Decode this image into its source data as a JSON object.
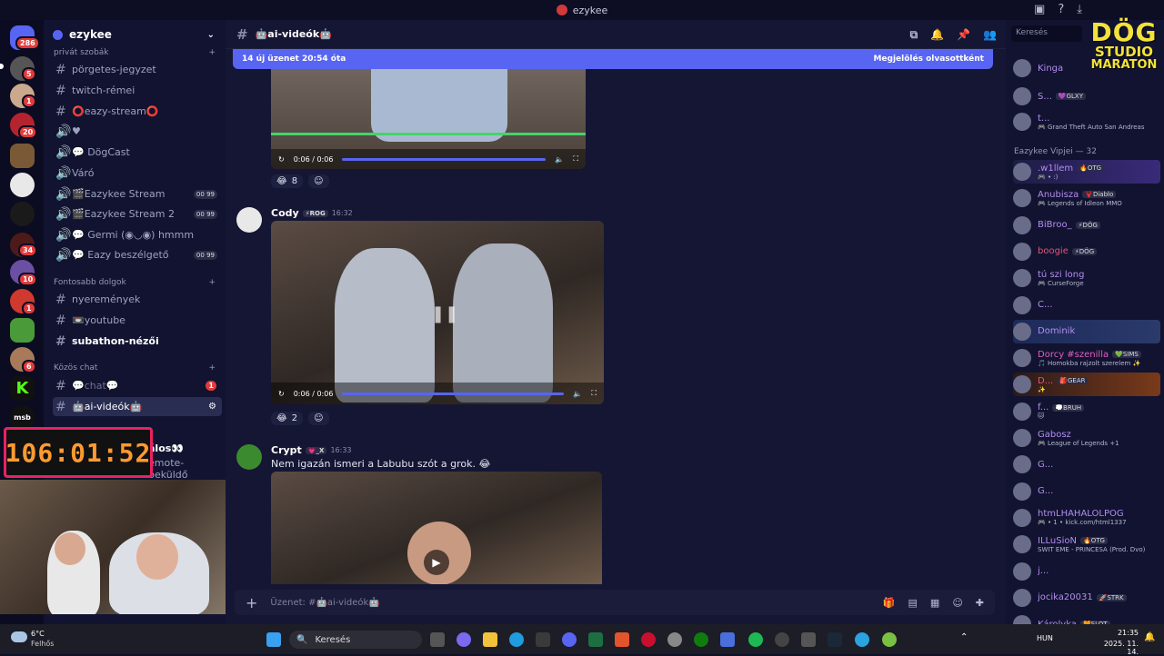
{
  "window": {
    "title": "ezykee"
  },
  "servers": {
    "badges": [
      "286",
      "5",
      "1",
      "20",
      "34",
      "10",
      "1",
      "6"
    ]
  },
  "server": {
    "name": "ezykee"
  },
  "channels": {
    "cat1": "privát szobák",
    "items1": [
      {
        "name": "pörgetes-jegyzet"
      },
      {
        "name": "twitch-rémei"
      },
      {
        "name": "⭕eazy-stream⭕"
      },
      {
        "name": "♥"
      },
      {
        "name": "💬 DögCast"
      },
      {
        "name": "Váró"
      },
      {
        "name": "🎬Eazykee Stream",
        "p1": "00",
        "p2": "99"
      },
      {
        "name": "🎬Eazykee Stream 2",
        "p1": "00",
        "p2": "99"
      },
      {
        "name": "💬 Germi (◉◡◉) hmmm"
      },
      {
        "name": "💬 Eazy beszélgető",
        "p1": "00",
        "p2": "99"
      }
    ],
    "cat2": "Fontosabb dolgok",
    "items2": [
      {
        "name": "nyeremények"
      },
      {
        "name": "📼youtube"
      },
      {
        "name": "subathon-nézői"
      }
    ],
    "cat3": "Közös chat",
    "items3": [
      {
        "name": "💬chat💬",
        "badge": "1"
      },
      {
        "name": "🤖ai-videók🤖"
      },
      {
        "name": "álos👀"
      },
      {
        "name": "emote-beküldő"
      }
    ]
  },
  "timer": "106:01:52",
  "header": {
    "channel": "🤖ai-videók🤖"
  },
  "newbar": {
    "left": "14 új üzenet 20:54 óta",
    "right": "Megjelölés olvasottként"
  },
  "messages": {
    "video1": {
      "time": "0:06 / 0:06",
      "react_count": "8"
    },
    "m2": {
      "user": "Cody",
      "tag": "⚡ROG",
      "time": "16:32",
      "video_time": "0:06 / 0:06",
      "react_count": "2"
    },
    "m3": {
      "user": "Crypt",
      "tag": "💗_X",
      "time": "16:33",
      "text": "Nem igazán ismeri a Labubu szót a grok. 😂"
    }
  },
  "composer": {
    "placeholder": "Üzenet: #🤖ai-videók🤖"
  },
  "members": {
    "search": "Keresés",
    "logo": [
      "DÖG",
      "STUDIO",
      "MARATON"
    ],
    "top": [
      {
        "name": "Kinga",
        "tag": "",
        "activity": "",
        "color": "#b38df0"
      },
      {
        "name": "S...",
        "tag": "💜GLXY",
        "activity": "",
        "color": "#b38df0"
      },
      {
        "name": "t...",
        "tag": "",
        "activity": "🎮 Grand Theft Auto San Andreas",
        "color": "#b38df0"
      }
    ],
    "section": "Eazykee Vipjei — 32",
    "list": [
      {
        "name": ".w1llem",
        "tag": "🔥OTG",
        "activity": "🎮 • :)",
        "color": "#b38df0"
      },
      {
        "name": "Anubisza",
        "tag": "🦞Diablo",
        "activity": "🎮 Legends of Idleon MMO",
        "color": "#b38df0"
      },
      {
        "name": "BiBroo_",
        "tag": "⚡DÖG",
        "activity": "",
        "color": "#b38df0"
      },
      {
        "name": "boogie",
        "tag": "⚡DÖG",
        "activity": "",
        "color": "#e0567a"
      },
      {
        "name": "tú szi long",
        "tag": "",
        "activity": "🎮 CurseForge",
        "color": "#b38df0"
      },
      {
        "name": "C...",
        "tag": "",
        "activity": "",
        "color": "#b38df0"
      },
      {
        "name": "Dominik",
        "tag": "",
        "activity": "",
        "color": "#b38df0"
      },
      {
        "name": "Dorcy #szenilla",
        "tag": "💚SIMS",
        "activity": "🎵 Homokba rajzolt szerelem ✨",
        "color": "#e05fbf"
      },
      {
        "name": "D...",
        "tag": "🎒GEAR",
        "activity": "✨",
        "color": "#e0567a"
      },
      {
        "name": "f...",
        "tag": "💭BRUH",
        "activity": "🐱",
        "color": "#b38df0"
      },
      {
        "name": "Gabosz",
        "tag": "",
        "activity": "🎮 League of Legends +1",
        "color": "#b38df0"
      },
      {
        "name": "G...",
        "tag": "",
        "activity": "",
        "color": "#b38df0"
      },
      {
        "name": "G...",
        "tag": "",
        "activity": "",
        "color": "#b38df0"
      },
      {
        "name": "htmLHAHALOLPOG",
        "tag": "",
        "activity": "🎮 • 1 • kick.com/html1337",
        "color": "#b38df0"
      },
      {
        "name": "ILLuSioN",
        "tag": "🔥OTG",
        "activity": "SWIT EME - PRINCESA (Prod. Dvo)",
        "color": "#b38df0"
      },
      {
        "name": "j...",
        "tag": "",
        "activity": "",
        "color": "#b38df0"
      },
      {
        "name": "jocika20031",
        "tag": "🚀STRK",
        "activity": "",
        "color": "#b38df0"
      },
      {
        "name": "Károlyka",
        "tag": "🧡SLOT",
        "activity": "",
        "color": "#b38df0"
      }
    ]
  },
  "taskbar": {
    "weather_temp": "6°C",
    "weather_desc": "Felhős",
    "search": "Keresés",
    "lang": "HUN",
    "time": "21:35",
    "date": "2025. 11. 14."
  }
}
